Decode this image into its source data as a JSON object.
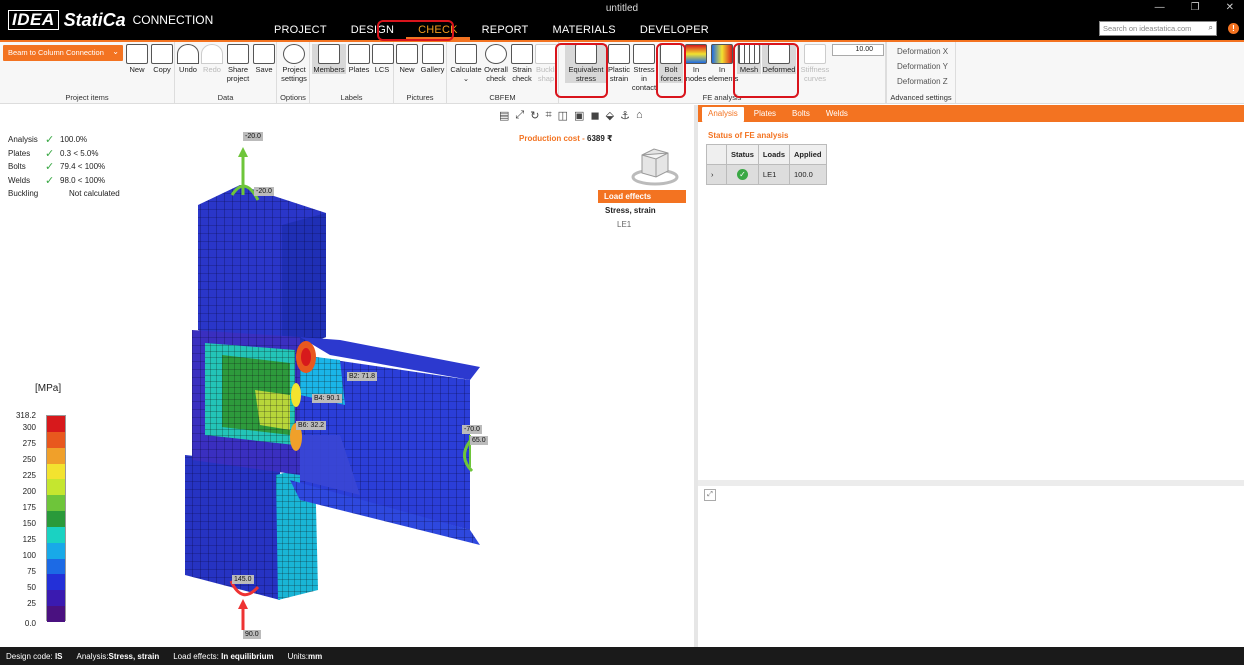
{
  "app": {
    "window_title": "untitled",
    "logo_idea": "IDEA",
    "logo_statica": "StatiCa",
    "logo_product": "CONNECTION",
    "search_placeholder": "Search on ideastatica.com",
    "notification_count": "!"
  },
  "main_tabs": [
    "PROJECT",
    "DESIGN",
    "CHECK",
    "REPORT",
    "MATERIALS",
    "DEVELOPER"
  ],
  "active_tab": "CHECK",
  "ribbon": {
    "project_selector": "Beam to Column Connection",
    "groups": {
      "project_items": "Project items",
      "data": "Data",
      "options": "Options",
      "labels": "Labels",
      "pictures": "Pictures",
      "cbfem": "CBFEM",
      "fe_analysis": "FE analysis",
      "advanced": "Advanced settings"
    },
    "buttons": {
      "new": "New",
      "copy": "Copy",
      "undo": "Undo",
      "redo": "Redo",
      "share_project_1": "Share",
      "share_project_2": "project",
      "save": "Save",
      "project_settings_1": "Project",
      "project_settings_2": "settings",
      "members": "Members",
      "plates": "Plates",
      "lcs": "LCS",
      "pic_new": "New",
      "gallery": "Gallery",
      "calculate": "Calculate",
      "overall_check_1": "Overall",
      "overall_check_2": "check",
      "strain_check_1": "Strain",
      "strain_check_2": "check",
      "bucklings_1": "Buckli",
      "bucklings_2": "shap",
      "equiv_stress_1": "Equivalent",
      "equiv_stress_2": "stress",
      "plastic_strain_1": "Plastic",
      "plastic_strain_2": "strain",
      "stress_contact_1": "Stress in",
      "stress_contact_2": "contact",
      "bolt_forces_1": "Bolt",
      "bolt_forces_2": "forces",
      "in_nodes_1": "In",
      "in_nodes_2": "nodes",
      "in_elements_1": "In",
      "in_elements_2": "elements",
      "mesh": "Mesh",
      "deformed": "Deformed",
      "stiffness_1": "Stiffness",
      "stiffness_2": "curves"
    },
    "deformation_scale": "10.00",
    "deformations": [
      "Deformation X",
      "Deformation Y",
      "Deformation Z"
    ]
  },
  "viewport": {
    "summary": [
      {
        "label": "Analysis",
        "check": true,
        "value": "100.0%"
      },
      {
        "label": "Plates",
        "check": true,
        "value": "0.3 < 5.0%"
      },
      {
        "label": "Bolts",
        "check": true,
        "value": "79.4 < 100%"
      },
      {
        "label": "Welds",
        "check": true,
        "value": "98.0 < 100%"
      },
      {
        "label": "Buckling",
        "check": false,
        "value": "Not calculated"
      }
    ],
    "production_cost_label": "Production cost",
    "production_cost_value": "6389 ₹",
    "legend_unit": "[MPa]",
    "legend_max": "318.2",
    "legend_ticks": [
      "300",
      "275",
      "250",
      "225",
      "200",
      "175",
      "150",
      "125",
      "100",
      "75",
      "50",
      "25",
      "0.0"
    ],
    "tree": {
      "root": "Load effects",
      "child": "Stress, strain",
      "leaf": "LE1"
    },
    "value_labels": [
      "-20.0",
      "-20.0",
      "B2: 71.8",
      "B4: 90.1",
      "B6: 32.2",
      "-70.0",
      "65.0",
      "145.0",
      "90.0"
    ]
  },
  "right_panel": {
    "tabs": [
      "Analysis",
      "Plates",
      "Bolts",
      "Welds"
    ],
    "active_tab": "Analysis",
    "status_title": "Status of FE analysis",
    "table_headers": [
      "Status",
      "Loads",
      "Applied"
    ],
    "table_rows": [
      {
        "status": "ok",
        "loads": "LE1",
        "applied": "100.0"
      }
    ]
  },
  "statusbar": {
    "design_code_label": "Design code:",
    "design_code": "IS",
    "analysis_label": "Analysis:",
    "analysis": "Stress, strain",
    "load_effects_label": "Load effects:",
    "load_effects": "In equilibrium",
    "units_label": "Units:",
    "units": "mm"
  },
  "colors": {
    "accent": "#f37321",
    "highlight_box": "#d9141c",
    "check_green": "#3aa845",
    "legend_scale": [
      "#d7191c",
      "#e8581e",
      "#f0a02a",
      "#f3e32f",
      "#c5e62f",
      "#6ec53a",
      "#2a9a3a",
      "#1ad2c2",
      "#18a9e8",
      "#1c6ae5",
      "#2330d8",
      "#3a1ab0",
      "#4a1180"
    ]
  }
}
